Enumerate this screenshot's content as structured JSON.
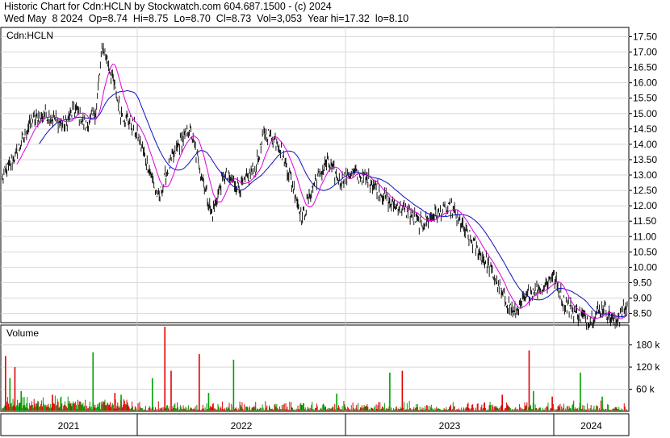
{
  "header": {
    "line1": "Historic Chart for Cdn:HCLN by Stockwatch.com 604.687.1500 - (c) 2024",
    "line2": "Wed May  8 2024  Op=8.74  Hi=8.75  Lo=8.70  Cl=8.73  Vol=3,053  Year hi=17.32  lo=8.10"
  },
  "chart_data": [
    {
      "type": "line",
      "label": "Cdn:HCLN",
      "y_ticks": [
        "17.50",
        "17.00",
        "16.50",
        "16.00",
        "15.50",
        "15.00",
        "14.50",
        "14.00",
        "13.50",
        "13.00",
        "12.50",
        "12.00",
        "11.50",
        "11.00",
        "10.50",
        "10.00",
        "9.50",
        "9.00",
        "8.50"
      ],
      "ylim": [
        8.2,
        17.8
      ],
      "x_ticks": [
        "2021",
        "2022",
        "2023",
        "2024"
      ],
      "grid": true,
      "colors": {
        "price": "#000000",
        "ma_short": "#e000e0",
        "ma_long": "#1010c0"
      },
      "price_anchors": [
        [
          0,
          12.9
        ],
        [
          0.02,
          13.6
        ],
        [
          0.045,
          14.7
        ],
        [
          0.07,
          15.0
        ],
        [
          0.1,
          14.6
        ],
        [
          0.115,
          15.2
        ],
        [
          0.135,
          14.6
        ],
        [
          0.15,
          15.1
        ],
        [
          0.16,
          17.2
        ],
        [
          0.17,
          16.6
        ],
        [
          0.19,
          15.0
        ],
        [
          0.21,
          14.6
        ],
        [
          0.23,
          13.5
        ],
        [
          0.25,
          12.2
        ],
        [
          0.265,
          13.2
        ],
        [
          0.28,
          13.9
        ],
        [
          0.3,
          14.5
        ],
        [
          0.32,
          12.9
        ],
        [
          0.335,
          11.7
        ],
        [
          0.355,
          13.0
        ],
        [
          0.38,
          12.6
        ],
        [
          0.405,
          13.2
        ],
        [
          0.42,
          14.4
        ],
        [
          0.44,
          14.1
        ],
        [
          0.46,
          13.0
        ],
        [
          0.48,
          11.6
        ],
        [
          0.5,
          12.8
        ],
        [
          0.52,
          13.4
        ],
        [
          0.54,
          12.8
        ],
        [
          0.56,
          13.1
        ],
        [
          0.59,
          12.8
        ],
        [
          0.62,
          12.1
        ],
        [
          0.65,
          11.8
        ],
        [
          0.67,
          11.4
        ],
        [
          0.69,
          11.7
        ],
        [
          0.72,
          11.9
        ],
        [
          0.73,
          11.5
        ],
        [
          0.75,
          10.9
        ],
        [
          0.78,
          10.0
        ],
        [
          0.8,
          9.1
        ],
        [
          0.82,
          8.5
        ],
        [
          0.845,
          9.2
        ],
        [
          0.87,
          9.4
        ],
        [
          0.88,
          9.8
        ],
        [
          0.9,
          8.8
        ],
        [
          0.92,
          8.5
        ],
        [
          0.94,
          8.3
        ],
        [
          0.96,
          8.7
        ],
        [
          0.98,
          8.2
        ],
        [
          1.0,
          8.73
        ]
      ]
    },
    {
      "type": "bar",
      "label": "Volume",
      "y_ticks": [
        "180 k",
        "120 k",
        "60 k"
      ],
      "ylim": [
        0,
        225
      ],
      "units": "k",
      "colors": {
        "up": "#00a000",
        "down": "#e00000"
      },
      "spikes": [
        [
          0.005,
          150,
          "down"
        ],
        [
          0.012,
          90,
          "up"
        ],
        [
          0.02,
          120,
          "down"
        ],
        [
          0.145,
          160,
          "up"
        ],
        [
          0.26,
          230,
          "down"
        ],
        [
          0.27,
          110,
          "down"
        ],
        [
          0.24,
          90,
          "up"
        ],
        [
          0.315,
          155,
          "down"
        ],
        [
          0.37,
          140,
          "up"
        ],
        [
          0.62,
          105,
          "up"
        ],
        [
          0.64,
          110,
          "down"
        ],
        [
          0.843,
          165,
          "down"
        ],
        [
          0.925,
          105,
          "up"
        ],
        [
          0.96,
          40,
          "up"
        ],
        [
          0.03,
          55,
          "up"
        ],
        [
          0.08,
          45,
          "down"
        ],
        [
          0.18,
          50,
          "down"
        ],
        [
          0.19,
          45,
          "up"
        ],
        [
          0.33,
          50,
          "up"
        ],
        [
          0.535,
          48,
          "up"
        ],
        [
          0.8,
          45,
          "down"
        ],
        [
          0.85,
          55,
          "up"
        ],
        [
          0.88,
          40,
          "down"
        ]
      ]
    }
  ]
}
